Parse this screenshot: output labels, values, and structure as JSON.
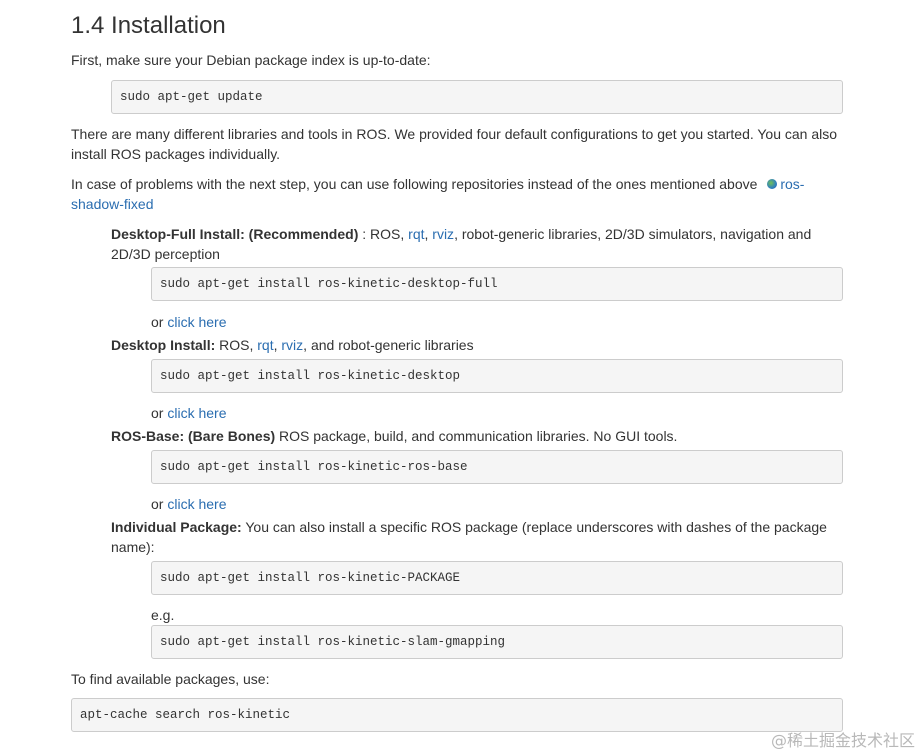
{
  "heading": "1.4 Installation",
  "intro": "First, make sure your Debian package index is up-to-date:",
  "cmd_update": "sudo apt-get update",
  "para1": "There are many different libraries and tools in ROS. We provided four default configurations to get you started. You can also install ROS packages individually.",
  "para2_prefix": "In case of problems with the next step, you can use following repositories instead of the ones mentioned above",
  "para2_link": "ros-shadow-fixed",
  "desktop_full": {
    "title": "Desktop-Full Install: (Recommended)",
    "sep": " : ROS, ",
    "rqt": "rqt",
    "rviz": "rviz",
    "rest": ", robot-generic libraries, 2D/3D simulators, navigation and 2D/3D perception",
    "cmd": "sudo apt-get install ros-kinetic-desktop-full",
    "or": "or ",
    "link": "click here"
  },
  "desktop": {
    "title": "Desktop Install:",
    "sep": " ROS, ",
    "rqt": "rqt",
    "rviz": "rviz",
    "rest": ", and robot-generic libraries",
    "cmd": "sudo apt-get install ros-kinetic-desktop",
    "or": "or ",
    "link": "click here"
  },
  "base": {
    "title": "ROS-Base: (Bare Bones)",
    "rest": " ROS package, build, and communication libraries. No GUI tools.",
    "cmd": "sudo apt-get install ros-kinetic-ros-base",
    "or": "or ",
    "link": "click here"
  },
  "individual": {
    "title": "Individual Package:",
    "rest": " You can also install a specific ROS package (replace underscores with dashes of the package name):",
    "cmd": "sudo apt-get install ros-kinetic-PACKAGE",
    "eg": "e.g.",
    "cmd_example": "sudo apt-get install ros-kinetic-slam-gmapping"
  },
  "find_text": "To find available packages, use:",
  "cmd_search": "apt-cache search ros-kinetic",
  "watermark": "@稀土掘金技术社区"
}
